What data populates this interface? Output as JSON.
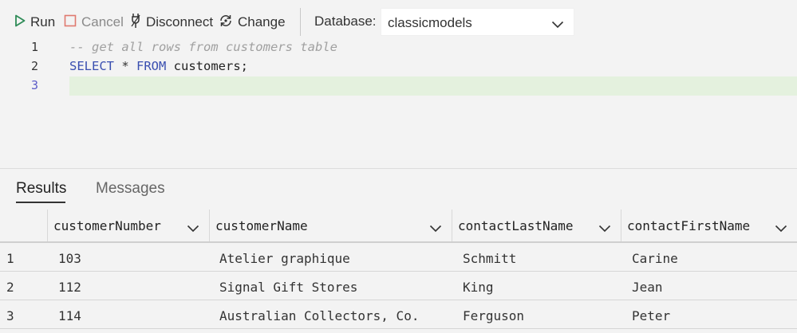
{
  "toolbar": {
    "run_label": "Run",
    "cancel_label": "Cancel",
    "disconnect_label": "Disconnect",
    "change_label": "Change",
    "database_label": "Database:",
    "database_value": "classicmodels",
    "run_icon": "play-icon",
    "cancel_icon": "stop-icon",
    "disconnect_icon": "unplug-icon",
    "change_icon": "change-connection-icon",
    "accent_run": "#2e8b57",
    "accent_cancel": "#d9534f"
  },
  "editor": {
    "lines": [
      {
        "number": "1",
        "text": "-- get all rows from customers table"
      },
      {
        "number": "2",
        "kw1": "SELECT",
        "op": " * ",
        "kw2": "FROM",
        "rest": " customers;"
      },
      {
        "number": "3",
        "text": ""
      }
    ],
    "current_line_color": "#e4f1de"
  },
  "results": {
    "tabs": [
      {
        "label": "Results",
        "active": true
      },
      {
        "label": "Messages",
        "active": false
      }
    ],
    "columns": [
      "customerNumber",
      "customerName",
      "contactLastName",
      "contactFirstName"
    ],
    "rows": [
      {
        "index": "1",
        "cells": [
          "103",
          "Atelier graphique",
          "Schmitt",
          "Carine"
        ]
      },
      {
        "index": "2",
        "cells": [
          "112",
          "Signal Gift Stores",
          "King",
          "Jean"
        ]
      },
      {
        "index": "3",
        "cells": [
          "114",
          "Australian Collectors, Co.",
          "Ferguson",
          "Peter"
        ]
      }
    ]
  }
}
